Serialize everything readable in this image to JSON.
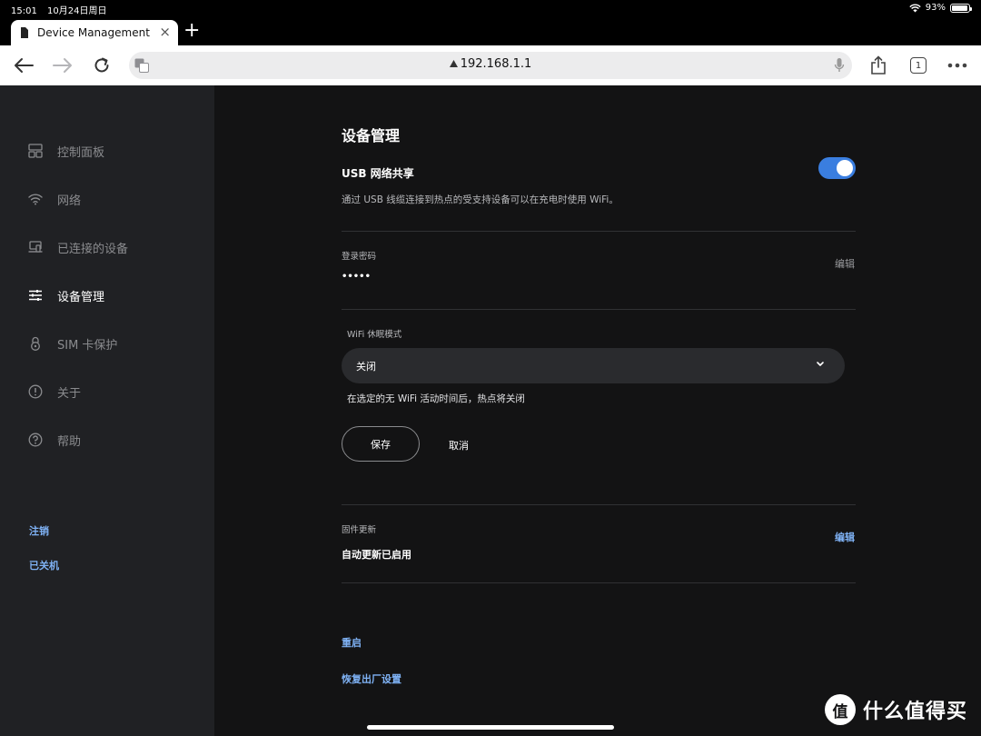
{
  "status_bar": {
    "time": "15:01",
    "date": "10月24日周日",
    "battery": "93%",
    "battery_level": 0.93
  },
  "browser": {
    "tab_title": "Device Management",
    "tab_close": "×",
    "new_tab": "+",
    "url": "192.168.1.1",
    "tab_count": "1"
  },
  "sidebar": {
    "items": [
      {
        "label": "控制面板",
        "icon": "dashboard-icon"
      },
      {
        "label": "网络",
        "icon": "wifi-icon"
      },
      {
        "label": "已连接的设备",
        "icon": "devices-icon"
      },
      {
        "label": "设备管理",
        "icon": "sliders-icon",
        "active": true
      },
      {
        "label": "SIM 卡保护",
        "icon": "lock-icon"
      },
      {
        "label": "关于",
        "icon": "info-icon"
      },
      {
        "label": "帮助",
        "icon": "help-icon"
      }
    ],
    "logout": "注销",
    "shutdown": "已关机"
  },
  "main": {
    "title": "设备管理",
    "usb": {
      "heading": "USB 网络共享",
      "description": "通过 USB 线缆连接到热点的受支持设备可以在充电时使用 WiFi。",
      "enabled": true
    },
    "password": {
      "label": "登录密码",
      "value": "•••••",
      "edit": "编辑"
    },
    "wifi_sleep": {
      "label": "WiFi 休眠模式",
      "selected": "关闭",
      "hint": "在选定的无 WiFi 活动时间后，热点将关闭",
      "save": "保存",
      "cancel": "取消"
    },
    "firmware": {
      "label": "固件更新",
      "value": "自动更新已启用",
      "edit": "编辑"
    },
    "restart": "重启",
    "factory_reset": "恢复出厂设置"
  },
  "watermark": {
    "badge": "值",
    "text": "什么值得买"
  },
  "colors": {
    "accent": "#3a7ee0",
    "link": "#7fb2f5",
    "sidebar_bg": "#202124",
    "main_bg": "#131314"
  }
}
